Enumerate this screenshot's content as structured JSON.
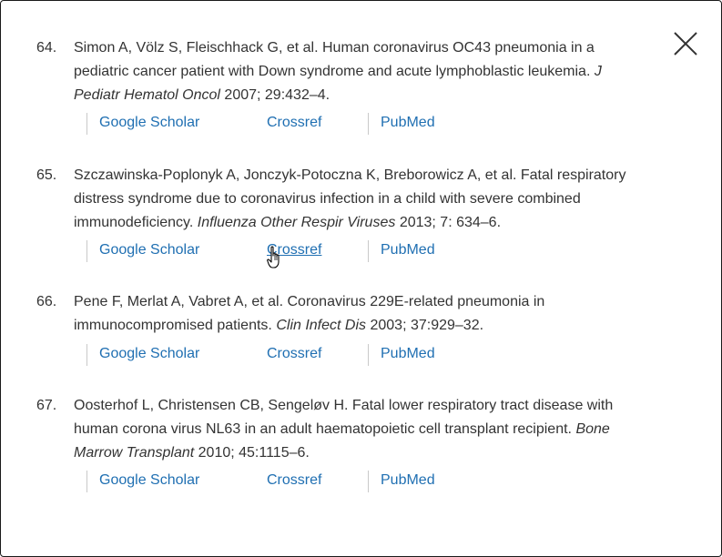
{
  "references": [
    {
      "number": "64.",
      "text": "Simon A, Völz S, Fleischhack G, et al.  Human coronavirus OC43 pneumonia in a pediatric cancer patient with Down syndrome and acute lymphoblastic leukemia.",
      "journal": "J Pediatr Hematol Oncol",
      "citation": "2007; 29:432–4.",
      "links": [
        "Google Scholar",
        "Crossref",
        "PubMed"
      ]
    },
    {
      "number": "65.",
      "text": "Szczawinska-Poplonyk A, Jonczyk-Potoczna K, Breborowicz A, et al.  Fatal respiratory distress syndrome due to coronavirus infection in a child with severe combined immunodeficiency.",
      "journal": "Influenza Other Respir Viruses",
      "citation": "2013; 7: 634–6.",
      "links": [
        "Google Scholar",
        "Crossref",
        "PubMed"
      ]
    },
    {
      "number": "66.",
      "text": "Pene F, Merlat A, Vabret A, et al.  Coronavirus 229E-related pneumonia in immunocompromised patients.",
      "journal": "Clin Infect Dis",
      "citation": "2003; 37:929–32.",
      "links": [
        "Google Scholar",
        "Crossref",
        "PubMed"
      ]
    },
    {
      "number": "67.",
      "text": "Oosterhof L, Christensen CB, Sengeløv H. Fatal lower respiratory tract disease with human corona virus NL63 in an adult haematopoietic cell transplant recipient.",
      "journal": "Bone Marrow Transplant",
      "citation": "2010; 45:1115–6.",
      "links": [
        "Google Scholar",
        "Crossref",
        "PubMed"
      ]
    }
  ],
  "colors": {
    "link": "#1f6fb2",
    "text": "#333333",
    "separator": "#c9c9c9"
  },
  "icons": {
    "close": "close-icon",
    "cursor": "hand-pointer-icon"
  }
}
